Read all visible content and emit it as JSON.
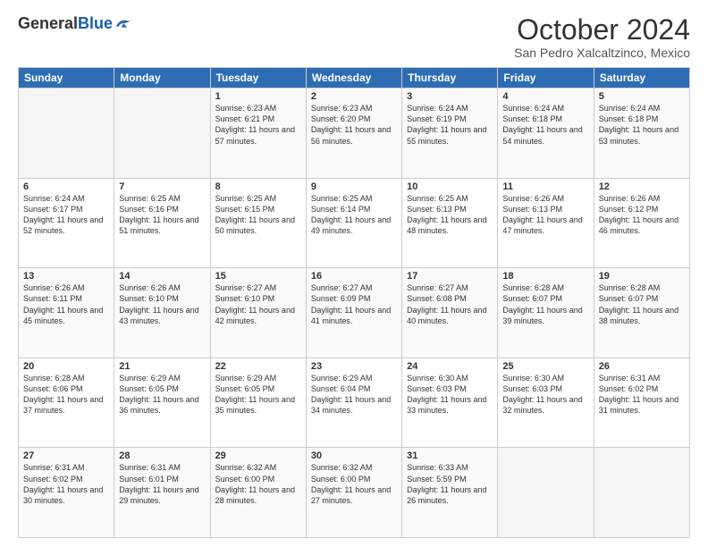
{
  "header": {
    "logo_general": "General",
    "logo_blue": "Blue",
    "month_title": "October 2024",
    "subtitle": "San Pedro Xalcaltzinco, Mexico"
  },
  "days_of_week": [
    "Sunday",
    "Monday",
    "Tuesday",
    "Wednesday",
    "Thursday",
    "Friday",
    "Saturday"
  ],
  "weeks": [
    [
      {
        "day": "",
        "sunrise": "",
        "sunset": "",
        "daylight": ""
      },
      {
        "day": "",
        "sunrise": "",
        "sunset": "",
        "daylight": ""
      },
      {
        "day": "1",
        "sunrise": "Sunrise: 6:23 AM",
        "sunset": "Sunset: 6:21 PM",
        "daylight": "Daylight: 11 hours and 57 minutes."
      },
      {
        "day": "2",
        "sunrise": "Sunrise: 6:23 AM",
        "sunset": "Sunset: 6:20 PM",
        "daylight": "Daylight: 11 hours and 56 minutes."
      },
      {
        "day": "3",
        "sunrise": "Sunrise: 6:24 AM",
        "sunset": "Sunset: 6:19 PM",
        "daylight": "Daylight: 11 hours and 55 minutes."
      },
      {
        "day": "4",
        "sunrise": "Sunrise: 6:24 AM",
        "sunset": "Sunset: 6:18 PM",
        "daylight": "Daylight: 11 hours and 54 minutes."
      },
      {
        "day": "5",
        "sunrise": "Sunrise: 6:24 AM",
        "sunset": "Sunset: 6:18 PM",
        "daylight": "Daylight: 11 hours and 53 minutes."
      }
    ],
    [
      {
        "day": "6",
        "sunrise": "Sunrise: 6:24 AM",
        "sunset": "Sunset: 6:17 PM",
        "daylight": "Daylight: 11 hours and 52 minutes."
      },
      {
        "day": "7",
        "sunrise": "Sunrise: 6:25 AM",
        "sunset": "Sunset: 6:16 PM",
        "daylight": "Daylight: 11 hours and 51 minutes."
      },
      {
        "day": "8",
        "sunrise": "Sunrise: 6:25 AM",
        "sunset": "Sunset: 6:15 PM",
        "daylight": "Daylight: 11 hours and 50 minutes."
      },
      {
        "day": "9",
        "sunrise": "Sunrise: 6:25 AM",
        "sunset": "Sunset: 6:14 PM",
        "daylight": "Daylight: 11 hours and 49 minutes."
      },
      {
        "day": "10",
        "sunrise": "Sunrise: 6:25 AM",
        "sunset": "Sunset: 6:13 PM",
        "daylight": "Daylight: 11 hours and 48 minutes."
      },
      {
        "day": "11",
        "sunrise": "Sunrise: 6:26 AM",
        "sunset": "Sunset: 6:13 PM",
        "daylight": "Daylight: 11 hours and 47 minutes."
      },
      {
        "day": "12",
        "sunrise": "Sunrise: 6:26 AM",
        "sunset": "Sunset: 6:12 PM",
        "daylight": "Daylight: 11 hours and 46 minutes."
      }
    ],
    [
      {
        "day": "13",
        "sunrise": "Sunrise: 6:26 AM",
        "sunset": "Sunset: 6:11 PM",
        "daylight": "Daylight: 11 hours and 45 minutes."
      },
      {
        "day": "14",
        "sunrise": "Sunrise: 6:26 AM",
        "sunset": "Sunset: 6:10 PM",
        "daylight": "Daylight: 11 hours and 43 minutes."
      },
      {
        "day": "15",
        "sunrise": "Sunrise: 6:27 AM",
        "sunset": "Sunset: 6:10 PM",
        "daylight": "Daylight: 11 hours and 42 minutes."
      },
      {
        "day": "16",
        "sunrise": "Sunrise: 6:27 AM",
        "sunset": "Sunset: 6:09 PM",
        "daylight": "Daylight: 11 hours and 41 minutes."
      },
      {
        "day": "17",
        "sunrise": "Sunrise: 6:27 AM",
        "sunset": "Sunset: 6:08 PM",
        "daylight": "Daylight: 11 hours and 40 minutes."
      },
      {
        "day": "18",
        "sunrise": "Sunrise: 6:28 AM",
        "sunset": "Sunset: 6:07 PM",
        "daylight": "Daylight: 11 hours and 39 minutes."
      },
      {
        "day": "19",
        "sunrise": "Sunrise: 6:28 AM",
        "sunset": "Sunset: 6:07 PM",
        "daylight": "Daylight: 11 hours and 38 minutes."
      }
    ],
    [
      {
        "day": "20",
        "sunrise": "Sunrise: 6:28 AM",
        "sunset": "Sunset: 6:06 PM",
        "daylight": "Daylight: 11 hours and 37 minutes."
      },
      {
        "day": "21",
        "sunrise": "Sunrise: 6:29 AM",
        "sunset": "Sunset: 6:05 PM",
        "daylight": "Daylight: 11 hours and 36 minutes."
      },
      {
        "day": "22",
        "sunrise": "Sunrise: 6:29 AM",
        "sunset": "Sunset: 6:05 PM",
        "daylight": "Daylight: 11 hours and 35 minutes."
      },
      {
        "day": "23",
        "sunrise": "Sunrise: 6:29 AM",
        "sunset": "Sunset: 6:04 PM",
        "daylight": "Daylight: 11 hours and 34 minutes."
      },
      {
        "day": "24",
        "sunrise": "Sunrise: 6:30 AM",
        "sunset": "Sunset: 6:03 PM",
        "daylight": "Daylight: 11 hours and 33 minutes."
      },
      {
        "day": "25",
        "sunrise": "Sunrise: 6:30 AM",
        "sunset": "Sunset: 6:03 PM",
        "daylight": "Daylight: 11 hours and 32 minutes."
      },
      {
        "day": "26",
        "sunrise": "Sunrise: 6:31 AM",
        "sunset": "Sunset: 6:02 PM",
        "daylight": "Daylight: 11 hours and 31 minutes."
      }
    ],
    [
      {
        "day": "27",
        "sunrise": "Sunrise: 6:31 AM",
        "sunset": "Sunset: 6:02 PM",
        "daylight": "Daylight: 11 hours and 30 minutes."
      },
      {
        "day": "28",
        "sunrise": "Sunrise: 6:31 AM",
        "sunset": "Sunset: 6:01 PM",
        "daylight": "Daylight: 11 hours and 29 minutes."
      },
      {
        "day": "29",
        "sunrise": "Sunrise: 6:32 AM",
        "sunset": "Sunset: 6:00 PM",
        "daylight": "Daylight: 11 hours and 28 minutes."
      },
      {
        "day": "30",
        "sunrise": "Sunrise: 6:32 AM",
        "sunset": "Sunset: 6:00 PM",
        "daylight": "Daylight: 11 hours and 27 minutes."
      },
      {
        "day": "31",
        "sunrise": "Sunrise: 6:33 AM",
        "sunset": "Sunset: 5:59 PM",
        "daylight": "Daylight: 11 hours and 26 minutes."
      },
      {
        "day": "",
        "sunrise": "",
        "sunset": "",
        "daylight": ""
      },
      {
        "day": "",
        "sunrise": "",
        "sunset": "",
        "daylight": ""
      }
    ]
  ]
}
